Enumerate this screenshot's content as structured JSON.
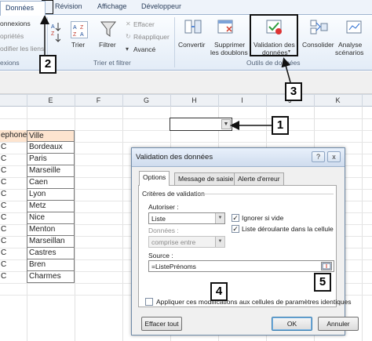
{
  "ribbon": {
    "tabs": [
      "Données",
      "Révision",
      "Affichage",
      "Développeur"
    ],
    "connections": [
      "onnexions",
      "opriétés",
      "odifier les liens"
    ],
    "connections_group": "exions",
    "sort": "Trier",
    "filter": "Filtrer",
    "clear": "Effacer",
    "reapply": "Réappliquer",
    "advanced": "Avancé",
    "sort_filter_group": "Trier et filtrer",
    "convert": "Convertir",
    "remove_dup": [
      "Supprimer",
      "les doublons"
    ],
    "validation": [
      "Validation des",
      "données"
    ],
    "consolidate": "Consolider",
    "whatif": [
      "Analyse",
      "scénarios"
    ],
    "data_tools_group": "Outils de données"
  },
  "sheet": {
    "columns": [
      "E",
      "F",
      "G",
      "H",
      "I",
      "J",
      "K"
    ],
    "col_c_header": "ephone",
    "col_e_header": "Ville",
    "cities": [
      "Bordeaux",
      "Paris",
      "Marseille",
      "Caen",
      "Lyon",
      "Metz",
      "Nice",
      "Menton",
      "Marseillan",
      "Castres",
      "Bren",
      "Charmes"
    ]
  },
  "callouts": [
    "1",
    "2",
    "3",
    "4",
    "5"
  ],
  "dialog": {
    "title": "Validation des données",
    "tabs": [
      "Options",
      "Message de saisie",
      "Alerte d'erreur"
    ],
    "criteria": "Critères de validation",
    "allow_label": "Autoriser :",
    "allow_value": "Liste",
    "ignore_blank": "Ignorer si vide",
    "in_cell_dropdown": "Liste déroulante dans la cellule",
    "data_label": "Données :",
    "data_value": "comprise entre",
    "source_label": "Source :",
    "source_value": "=ListePrénoms",
    "apply_all": "Appliquer ces modifications aux cellules de paramètres identiques",
    "clear_all": "Effacer tout",
    "ok": "OK",
    "cancel": "Annuler",
    "help": "?",
    "close": "x"
  }
}
